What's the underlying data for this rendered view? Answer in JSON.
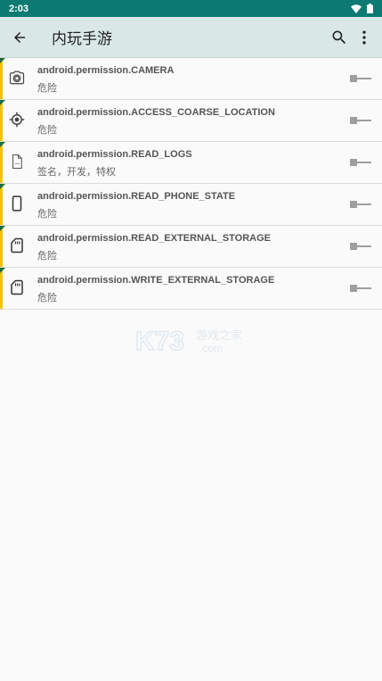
{
  "status_bar": {
    "time": "2:03"
  },
  "app_bar": {
    "title": "内玩手游"
  },
  "permissions": [
    {
      "name": "android.permission.CAMERA",
      "level": "危险",
      "icon": "camera-icon"
    },
    {
      "name": "android.permission.ACCESS_COARSE_LOCATION",
      "level": "危险",
      "icon": "location-icon"
    },
    {
      "name": "android.permission.READ_LOGS",
      "level": "签名，开发，特权",
      "icon": "log-file-icon"
    },
    {
      "name": "android.permission.READ_PHONE_STATE",
      "level": "危险",
      "icon": "phone-icon"
    },
    {
      "name": "android.permission.READ_EXTERNAL_STORAGE",
      "level": "危险",
      "icon": "sd-card-icon"
    },
    {
      "name": "android.permission.WRITE_EXTERNAL_STORAGE",
      "level": "危险",
      "icon": "sd-card-icon"
    }
  ],
  "watermark": {
    "brand": "K73",
    "site": "游戏之家",
    "domain": ".com"
  },
  "colors": {
    "status_bar": "#0c7a73",
    "app_bar": "#d9e8e6",
    "row_marker": "#f2c300",
    "row_corner": "#1f6e36"
  }
}
